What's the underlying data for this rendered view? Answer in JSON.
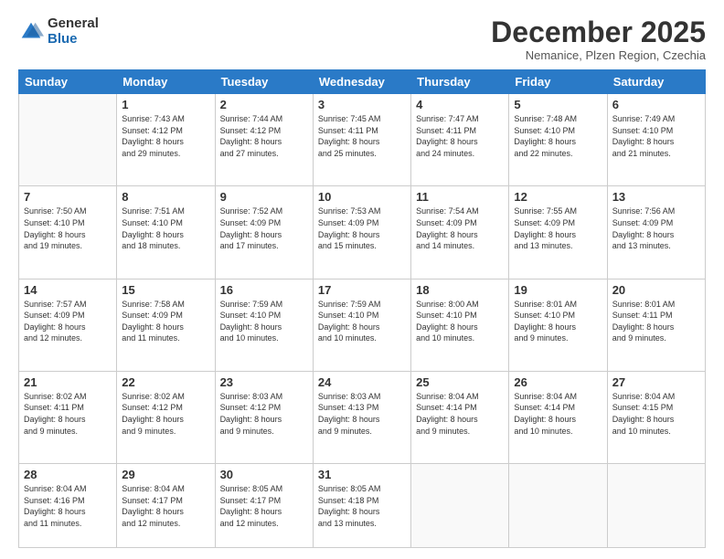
{
  "header": {
    "logo_general": "General",
    "logo_blue": "Blue",
    "month_title": "December 2025",
    "location": "Nemanice, Plzen Region, Czechia"
  },
  "days_of_week": [
    "Sunday",
    "Monday",
    "Tuesday",
    "Wednesday",
    "Thursday",
    "Friday",
    "Saturday"
  ],
  "weeks": [
    [
      {
        "day": "",
        "info": ""
      },
      {
        "day": "1",
        "info": "Sunrise: 7:43 AM\nSunset: 4:12 PM\nDaylight: 8 hours\nand 29 minutes."
      },
      {
        "day": "2",
        "info": "Sunrise: 7:44 AM\nSunset: 4:12 PM\nDaylight: 8 hours\nand 27 minutes."
      },
      {
        "day": "3",
        "info": "Sunrise: 7:45 AM\nSunset: 4:11 PM\nDaylight: 8 hours\nand 25 minutes."
      },
      {
        "day": "4",
        "info": "Sunrise: 7:47 AM\nSunset: 4:11 PM\nDaylight: 8 hours\nand 24 minutes."
      },
      {
        "day": "5",
        "info": "Sunrise: 7:48 AM\nSunset: 4:10 PM\nDaylight: 8 hours\nand 22 minutes."
      },
      {
        "day": "6",
        "info": "Sunrise: 7:49 AM\nSunset: 4:10 PM\nDaylight: 8 hours\nand 21 minutes."
      }
    ],
    [
      {
        "day": "7",
        "info": "Sunrise: 7:50 AM\nSunset: 4:10 PM\nDaylight: 8 hours\nand 19 minutes."
      },
      {
        "day": "8",
        "info": "Sunrise: 7:51 AM\nSunset: 4:10 PM\nDaylight: 8 hours\nand 18 minutes."
      },
      {
        "day": "9",
        "info": "Sunrise: 7:52 AM\nSunset: 4:09 PM\nDaylight: 8 hours\nand 17 minutes."
      },
      {
        "day": "10",
        "info": "Sunrise: 7:53 AM\nSunset: 4:09 PM\nDaylight: 8 hours\nand 15 minutes."
      },
      {
        "day": "11",
        "info": "Sunrise: 7:54 AM\nSunset: 4:09 PM\nDaylight: 8 hours\nand 14 minutes."
      },
      {
        "day": "12",
        "info": "Sunrise: 7:55 AM\nSunset: 4:09 PM\nDaylight: 8 hours\nand 13 minutes."
      },
      {
        "day": "13",
        "info": "Sunrise: 7:56 AM\nSunset: 4:09 PM\nDaylight: 8 hours\nand 13 minutes."
      }
    ],
    [
      {
        "day": "14",
        "info": "Sunrise: 7:57 AM\nSunset: 4:09 PM\nDaylight: 8 hours\nand 12 minutes."
      },
      {
        "day": "15",
        "info": "Sunrise: 7:58 AM\nSunset: 4:09 PM\nDaylight: 8 hours\nand 11 minutes."
      },
      {
        "day": "16",
        "info": "Sunrise: 7:59 AM\nSunset: 4:10 PM\nDaylight: 8 hours\nand 10 minutes."
      },
      {
        "day": "17",
        "info": "Sunrise: 7:59 AM\nSunset: 4:10 PM\nDaylight: 8 hours\nand 10 minutes."
      },
      {
        "day": "18",
        "info": "Sunrise: 8:00 AM\nSunset: 4:10 PM\nDaylight: 8 hours\nand 10 minutes."
      },
      {
        "day": "19",
        "info": "Sunrise: 8:01 AM\nSunset: 4:10 PM\nDaylight: 8 hours\nand 9 minutes."
      },
      {
        "day": "20",
        "info": "Sunrise: 8:01 AM\nSunset: 4:11 PM\nDaylight: 8 hours\nand 9 minutes."
      }
    ],
    [
      {
        "day": "21",
        "info": "Sunrise: 8:02 AM\nSunset: 4:11 PM\nDaylight: 8 hours\nand 9 minutes."
      },
      {
        "day": "22",
        "info": "Sunrise: 8:02 AM\nSunset: 4:12 PM\nDaylight: 8 hours\nand 9 minutes."
      },
      {
        "day": "23",
        "info": "Sunrise: 8:03 AM\nSunset: 4:12 PM\nDaylight: 8 hours\nand 9 minutes."
      },
      {
        "day": "24",
        "info": "Sunrise: 8:03 AM\nSunset: 4:13 PM\nDaylight: 8 hours\nand 9 minutes."
      },
      {
        "day": "25",
        "info": "Sunrise: 8:04 AM\nSunset: 4:14 PM\nDaylight: 8 hours\nand 9 minutes."
      },
      {
        "day": "26",
        "info": "Sunrise: 8:04 AM\nSunset: 4:14 PM\nDaylight: 8 hours\nand 10 minutes."
      },
      {
        "day": "27",
        "info": "Sunrise: 8:04 AM\nSunset: 4:15 PM\nDaylight: 8 hours\nand 10 minutes."
      }
    ],
    [
      {
        "day": "28",
        "info": "Sunrise: 8:04 AM\nSunset: 4:16 PM\nDaylight: 8 hours\nand 11 minutes."
      },
      {
        "day": "29",
        "info": "Sunrise: 8:04 AM\nSunset: 4:17 PM\nDaylight: 8 hours\nand 12 minutes."
      },
      {
        "day": "30",
        "info": "Sunrise: 8:05 AM\nSunset: 4:17 PM\nDaylight: 8 hours\nand 12 minutes."
      },
      {
        "day": "31",
        "info": "Sunrise: 8:05 AM\nSunset: 4:18 PM\nDaylight: 8 hours\nand 13 minutes."
      },
      {
        "day": "",
        "info": ""
      },
      {
        "day": "",
        "info": ""
      },
      {
        "day": "",
        "info": ""
      }
    ]
  ]
}
